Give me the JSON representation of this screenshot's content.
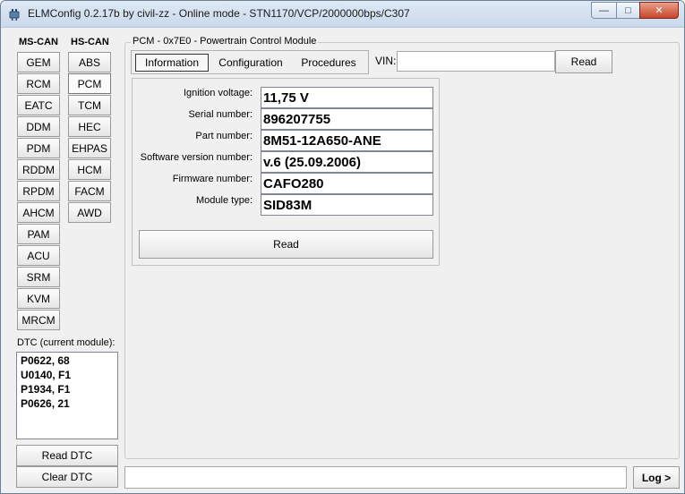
{
  "window": {
    "title": "ELMConfig 0.2.17b by civil-zz - Online mode - STN1170/VCP/2000000bps/C307",
    "icon": "elmconfig-app-icon",
    "buttons": [
      "minimize-icon",
      "maximize-icon",
      "close-icon"
    ]
  },
  "ms_can": {
    "label": "MS-CAN",
    "modules": [
      "GEM",
      "RCM",
      "EATC",
      "DDM",
      "PDM",
      "RDDM",
      "RPDM",
      "AHCM",
      "PAM",
      "ACU",
      "SRM",
      "KVM",
      "MRCM"
    ]
  },
  "hs_can": {
    "label": "HS-CAN",
    "modules": [
      "ABS",
      "PCM",
      "TCM",
      "HEC",
      "EHPAS",
      "HCM",
      "FACM",
      "AWD"
    ],
    "selected": "PCM"
  },
  "dtc": {
    "label": "DTC (current module):",
    "codes": [
      "P0622, 68",
      "U0140, F1",
      "P1934, F1",
      "P0626, 21"
    ],
    "read_label": "Read DTC",
    "clear_label": "Clear DTC"
  },
  "module_panel": {
    "title": "PCM - 0x7E0 - Powertrain Control Module",
    "tabs": [
      "Information",
      "Configuration",
      "Procedures"
    ],
    "active_tab": "Information",
    "vin_label": "VIN:",
    "vin_value": "",
    "read_vin_label": "Read"
  },
  "info": {
    "fields": [
      {
        "label": "Ignition voltage:",
        "value": "11,75 V"
      },
      {
        "label": "Serial number:",
        "value": "896207755"
      },
      {
        "label": "Part number:",
        "value": "8M51-12A650-ANE"
      },
      {
        "label": "Software version number:",
        "value": "v.6 (25.09.2006)"
      },
      {
        "label": "Firmware number:",
        "value": "CAFO280"
      },
      {
        "label": "Module type:",
        "value": "SID83M"
      }
    ],
    "read_label": "Read"
  },
  "log": {
    "value": "",
    "button_label": "Log >"
  }
}
